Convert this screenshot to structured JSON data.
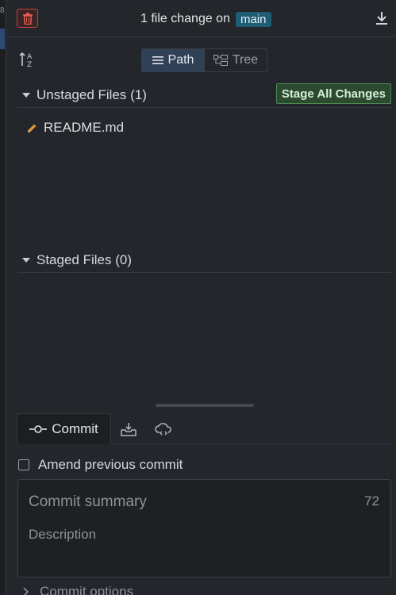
{
  "header": {
    "title": "1 file change on",
    "branch": "main",
    "trash_icon": "trash-icon",
    "download_icon": "download-icon"
  },
  "toolbar": {
    "sort_icon": "sort-alpha-icon",
    "view_modes": [
      "Path",
      "Tree"
    ],
    "active_view": "Path"
  },
  "unstaged": {
    "title": "Unstaged Files (1)",
    "stage_all_label": "Stage All Changes",
    "files": [
      {
        "name": "README.md",
        "status_icon": "pencil-icon"
      }
    ]
  },
  "staged": {
    "title": "Staged Files (0)"
  },
  "tabs": {
    "commit_label": "Commit",
    "icons": [
      "commit-icon",
      "stash-icon",
      "cloud-icon"
    ]
  },
  "commit": {
    "amend_label": "Amend previous commit",
    "summary_placeholder": "Commit summary",
    "char_count": "72",
    "description_placeholder": "Description",
    "options_label": "Commit options"
  },
  "colors": {
    "background": "#23262b",
    "branch_badge": "#1f5d74",
    "stage_all": "#2b4a2f",
    "trash_border": "#c4453f",
    "active_segment": "#2f4057"
  }
}
